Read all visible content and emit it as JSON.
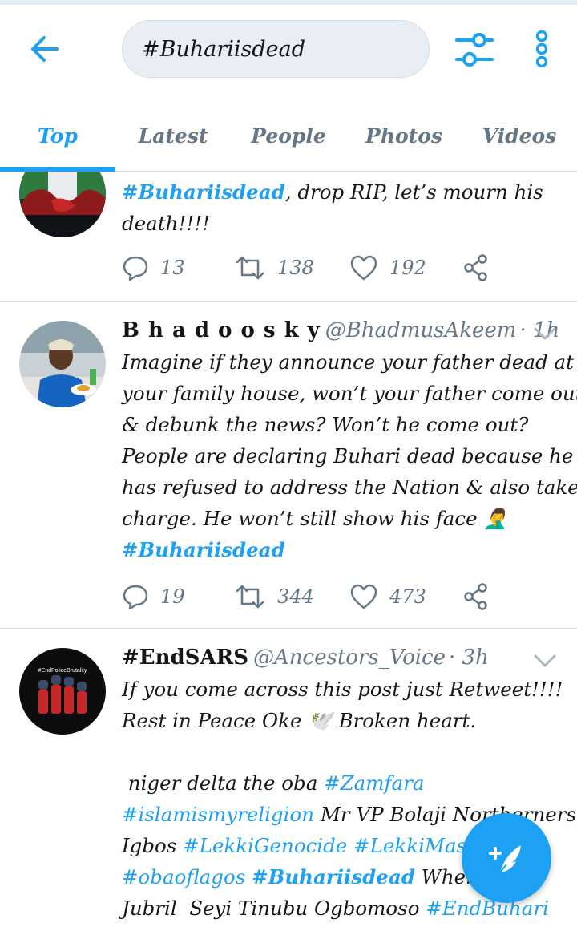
{
  "search": {
    "query": "#Buhariisdead"
  },
  "tabs": [
    "Top",
    "Latest",
    "People",
    "Photos",
    "Videos"
  ],
  "tweets": [
    {
      "body": [
        [
          {
            "t": "#Buhariisdead",
            "c": "hlb"
          },
          {
            "t": ", drop RIP, let’s mourn his"
          }
        ],
        [
          {
            "t": "death!!!!"
          }
        ]
      ],
      "replies": "13",
      "retweets": "138",
      "likes": "192"
    },
    {
      "name": "B h a d o o s k y",
      "handle": "@BhadmusAkeem",
      "time": "· 1h",
      "body": [
        [
          {
            "t": "Imagine if they announce your father dead at"
          }
        ],
        [
          {
            "t": "your family house, won’t your father come out"
          }
        ],
        [
          {
            "t": "& debunk the news? Won’t he come out?"
          }
        ],
        [
          {
            "t": "People are declaring Buhari dead because he"
          }
        ],
        [
          {
            "t": "has refused to address the Nation & also take"
          }
        ],
        [
          {
            "t": "charge. He won’t still show his face 🤦‍♂️"
          }
        ],
        [
          {
            "t": "#Buhariisdead",
            "c": "hlb"
          }
        ]
      ],
      "replies": "19",
      "retweets": "344",
      "likes": "473"
    },
    {
      "name": "#EndSARS",
      "handle": "@Ancestors_Voice",
      "time": "· 3h",
      "avatar_text": "#EndPoliceBrutality",
      "body": [
        [
          {
            "t": "If you come across this post just Retweet!!!!"
          }
        ],
        [
          {
            "t": "Rest in Peace Oke 🕊️ Broken heart."
          }
        ],
        [
          {
            "t": " "
          }
        ],
        [
          {
            "t": " niger delta the oba "
          },
          {
            "t": "#Zamfara",
            "c": "hl"
          }
        ],
        [
          {
            "t": "#islamismyreligion",
            "c": "hl"
          },
          {
            "t": " Mr VP Bolaji Northerners"
          }
        ],
        [
          {
            "t": "Igbos "
          },
          {
            "t": "#LekkiGenocide",
            "c": "hl"
          },
          {
            "t": " "
          },
          {
            "t": "#LekkiMassa",
            "c": "hl"
          }
        ],
        [
          {
            "t": "#obaoflagos",
            "c": "hl"
          },
          {
            "t": " "
          },
          {
            "t": "#Buhariisdead",
            "c": "hlb"
          },
          {
            "t": " Where is"
          }
        ],
        [
          {
            "t": "Jubril  Seyi Tinubu Ogbomoso "
          },
          {
            "t": "#EndBuhari",
            "c": "hl"
          }
        ]
      ]
    }
  ],
  "colors": {
    "accent": "#1da1f2",
    "secondary_text": "#657786",
    "divider": "#d8dfe4"
  },
  "icons": [
    "back-arrow-icon",
    "filter-sliders-icon",
    "overflow-menu-icon",
    "reply-icon",
    "retweet-icon",
    "like-icon",
    "share-icon",
    "chevron-down-icon",
    "compose-tweet-icon"
  ]
}
